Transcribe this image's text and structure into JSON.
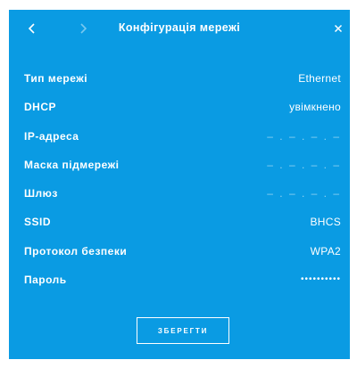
{
  "header": {
    "title": "Конфігурація мережі"
  },
  "colors": {
    "panel_background": "#0a9be3",
    "text": "#ffffff"
  },
  "icons": {
    "back": "chevron-left-icon",
    "forward": "chevron-right-icon",
    "close": "close-icon"
  },
  "settings": [
    {
      "label": "Тип мережі",
      "value": "Ethernet"
    },
    {
      "label": "DHCP",
      "value": "увімкнено"
    },
    {
      "label": "IP-адреса",
      "value": "– . – . – . –"
    },
    {
      "label": "Маска підмережі",
      "value": "– . – . – . –"
    },
    {
      "label": "Шлюз",
      "value": "– . – . – . –"
    },
    {
      "label": "SSID",
      "value": "BHCS"
    },
    {
      "label": "Протокол безпеки",
      "value": "WPA2"
    },
    {
      "label": "Пароль",
      "value": "••••••••••"
    }
  ],
  "save_button": {
    "label": "ЗБЕРЕГТИ"
  }
}
